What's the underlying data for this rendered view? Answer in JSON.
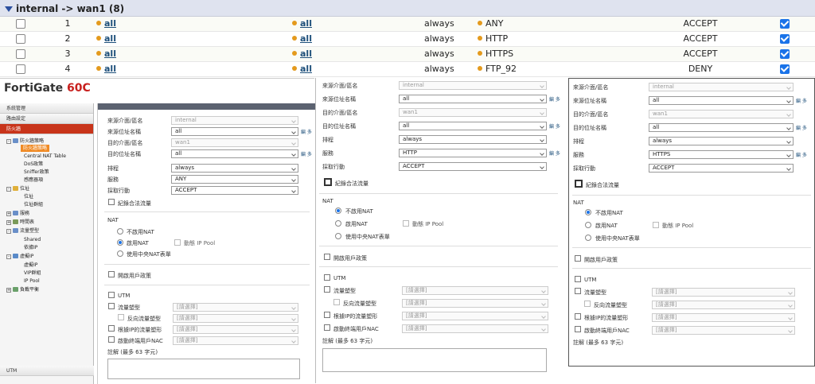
{
  "policy_group": {
    "title": "internal -> wan1 (8)",
    "rows": [
      {
        "id": "1",
        "source": "all",
        "destination": "all",
        "schedule": "always",
        "service": "ANY",
        "action": "ACCEPT"
      },
      {
        "id": "2",
        "source": "all",
        "destination": "all",
        "schedule": "always",
        "service": "HTTP",
        "action": "ACCEPT"
      },
      {
        "id": "3",
        "source": "all",
        "destination": "all",
        "schedule": "always",
        "service": "HTTPS",
        "action": "ACCEPT"
      },
      {
        "id": "4",
        "source": "all",
        "destination": "all",
        "schedule": "always",
        "service": "FTP_92",
        "action": "DENY"
      }
    ]
  },
  "left_panel": {
    "brand_name": "FortiGate ",
    "brand_model": "60C",
    "sidebar_sections": [
      "系統管理",
      "路由設定",
      "防火牆"
    ],
    "tree": [
      "防火牆策略",
      "防火牆策略",
      "Central NAT Table",
      "DoS政策",
      "Sniffer政策",
      "感應器項",
      "位址",
      "位址",
      "位址群組",
      "服務",
      "時間表",
      "流量塑型",
      "Shared",
      "依據IP",
      "虛擬IP",
      "虛擬IP",
      "VIP群組",
      "IP Pool",
      "負載平衡"
    ],
    "sidebar_bottom": [
      "UTM"
    ],
    "form": {
      "src_intf_label": "來源介面/區名",
      "src_intf": "internal",
      "src_addr_label": "來源位址名稱",
      "src_addr": "all",
      "dst_intf_label": "目的介面/區名",
      "dst_intf": "wan1",
      "dst_addr_label": "目的位址名稱",
      "dst_addr": "all",
      "schedule_label": "排程",
      "schedule": "always",
      "service_label": "服務",
      "service": "ANY",
      "action_label": "採取行動",
      "action": "ACCEPT",
      "log_label": "紀錄合法流量",
      "nat_title": "NAT",
      "nat_opt1": "不啟用NAT",
      "nat_opt2": "啟用NAT",
      "nat_opt3": "使用中央NAT表單",
      "dyn_pool": "動態 IP Pool",
      "auth_label": "開啟用戶政策",
      "utm_label": "UTM",
      "traffic_shaping": "流量塑型",
      "reverse_shaping": "反向流量塑型",
      "perip_shaping": "根據IP的流量塑形",
      "endpoint_nac": "啟動終端用戶NAC",
      "placeholder": "[請選擇]",
      "comment_label": "註解 (最多 63 字元)"
    }
  },
  "mid_panel": {
    "src_intf": "internal",
    "src_addr": "all",
    "dst_intf": "wan1",
    "dst_addr": "all",
    "schedule": "always",
    "service": "HTTP",
    "action": "ACCEPT"
  },
  "right_panel": {
    "src_intf": "internal",
    "src_addr": "all",
    "dst_intf": "wan1",
    "dst_addr": "all",
    "schedule": "always",
    "service": "HTTPS",
    "action": "ACCEPT"
  },
  "edit_link": "編 多"
}
